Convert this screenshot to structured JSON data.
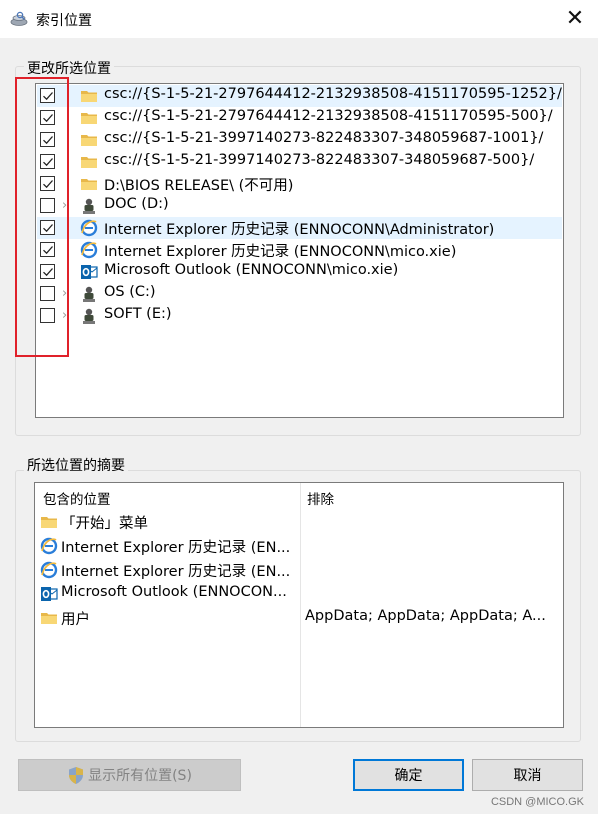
{
  "window": {
    "title": "索引位置",
    "close_glyph": "✕"
  },
  "change_group": {
    "label": "更改所选位置",
    "items": [
      {
        "text": "csc://{S-1-5-21-2797644412-2132938508-4151170595-1252}/",
        "checked": true,
        "icon": "folder-icon",
        "expandable": false
      },
      {
        "text": "csc://{S-1-5-21-2797644412-2132938508-4151170595-500}/",
        "checked": true,
        "icon": "folder-icon",
        "expandable": false
      },
      {
        "text": "csc://{S-1-5-21-3997140273-822483307-348059687-1001}/",
        "checked": true,
        "icon": "folder-icon",
        "expandable": false
      },
      {
        "text": "csc://{S-1-5-21-3997140273-822483307-348059687-500}/",
        "checked": true,
        "icon": "folder-icon",
        "expandable": false
      },
      {
        "text": "D:\\BIOS RELEASE\\ (不可用)",
        "checked": true,
        "icon": "folder-icon",
        "expandable": false
      },
      {
        "text": "DOC (D:)",
        "checked": false,
        "icon": "drive-icon",
        "expandable": true
      },
      {
        "text": "Internet Explorer 历史记录 (ENNOCONN\\Administrator)",
        "checked": true,
        "icon": "ie-icon",
        "expandable": false
      },
      {
        "text": "Internet Explorer 历史记录 (ENNOCONN\\mico.xie)",
        "checked": true,
        "icon": "ie-icon",
        "expandable": false
      },
      {
        "text": "Microsoft Outlook (ENNOCONN\\mico.xie)",
        "checked": true,
        "icon": "outlook-icon",
        "expandable": false
      },
      {
        "text": "OS (C:)",
        "checked": false,
        "icon": "drive-icon",
        "expandable": true
      },
      {
        "text": "SOFT (E:)",
        "checked": false,
        "icon": "drive-icon",
        "expandable": true
      }
    ]
  },
  "summary_group": {
    "label": "所选位置的摘要",
    "col_included": "包含的位置",
    "col_excluded": "排除",
    "rows": [
      {
        "icon": "folder-icon",
        "included": "「开始」菜单",
        "excluded": ""
      },
      {
        "icon": "ie-icon",
        "included": "Internet Explorer 历史记录 (EN...",
        "excluded": ""
      },
      {
        "icon": "ie-icon",
        "included": "Internet Explorer 历史记录 (EN...",
        "excluded": ""
      },
      {
        "icon": "outlook-icon",
        "included": "Microsoft Outlook (ENNOCON...",
        "excluded": ""
      },
      {
        "icon": "folder-icon",
        "included": "用户",
        "excluded": "AppData; AppData; AppData; A..."
      }
    ]
  },
  "buttons": {
    "show_all": "显示所有位置(S)",
    "ok": "确定",
    "cancel": "取消"
  },
  "watermark": "CSDN @MICO.GK"
}
